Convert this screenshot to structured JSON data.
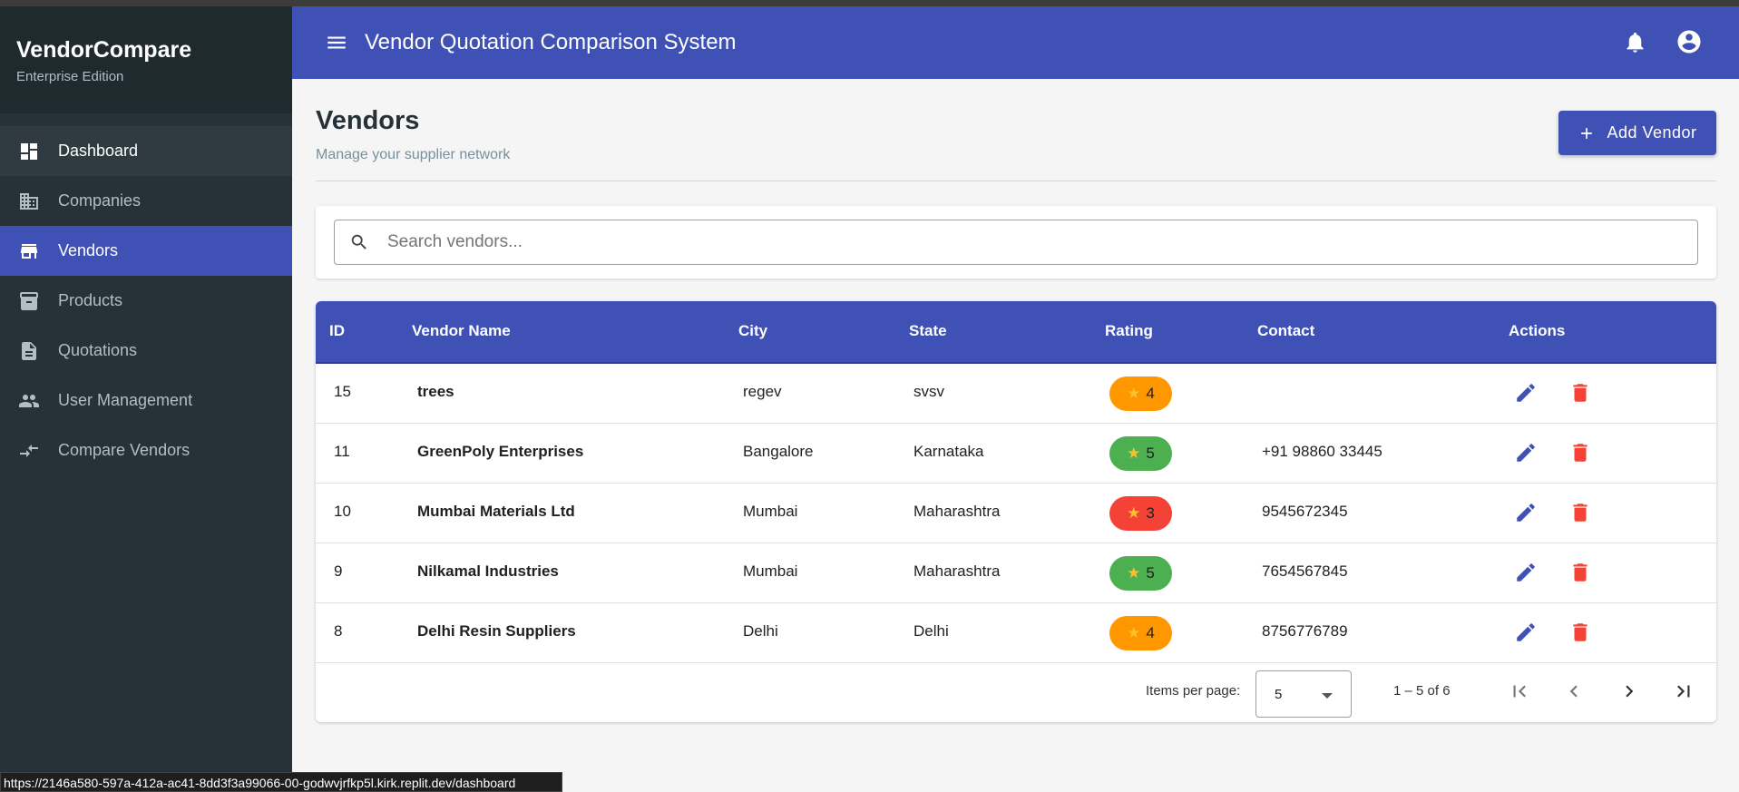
{
  "brand": {
    "title": "VendorCompare",
    "subtitle": "Enterprise Edition"
  },
  "sidebar": {
    "items": [
      {
        "label": "Dashboard",
        "icon": "dashboard-icon"
      },
      {
        "label": "Companies",
        "icon": "business-icon"
      },
      {
        "label": "Vendors",
        "icon": "store-icon",
        "active": true
      },
      {
        "label": "Products",
        "icon": "inventory-icon"
      },
      {
        "label": "Quotations",
        "icon": "document-icon"
      },
      {
        "label": "User Management",
        "icon": "people-icon"
      },
      {
        "label": "Compare Vendors",
        "icon": "compare-icon"
      }
    ]
  },
  "topbar": {
    "title": "Vendor Quotation Comparison System"
  },
  "page": {
    "title": "Vendors",
    "subtitle": "Manage your supplier network",
    "add_label": "Add Vendor"
  },
  "search": {
    "placeholder": "Search vendors...",
    "value": ""
  },
  "table": {
    "headers": {
      "id": "ID",
      "name": "Vendor Name",
      "city": "City",
      "state": "State",
      "rating": "Rating",
      "contact": "Contact",
      "actions": "Actions"
    },
    "rows": [
      {
        "id": "15",
        "name": "trees",
        "city": "regev",
        "state": "svsv",
        "rating": "4",
        "rating_color": "#ff9800",
        "contact": ""
      },
      {
        "id": "11",
        "name": "GreenPoly Enterprises",
        "city": "Bangalore",
        "state": "Karnataka",
        "rating": "5",
        "rating_color": "#4caf50",
        "contact": "+91 98860 33445"
      },
      {
        "id": "10",
        "name": "Mumbai Materials Ltd",
        "city": "Mumbai",
        "state": "Maharashtra",
        "rating": "3",
        "rating_color": "#f44336",
        "contact": "9545672345"
      },
      {
        "id": "9",
        "name": "Nilkamal Industries",
        "city": "Mumbai",
        "state": "Maharashtra",
        "rating": "5",
        "rating_color": "#4caf50",
        "contact": "7654567845"
      },
      {
        "id": "8",
        "name": "Delhi Resin Suppliers",
        "city": "Delhi",
        "state": "Delhi",
        "rating": "4",
        "rating_color": "#ff9800",
        "contact": "8756776789"
      }
    ]
  },
  "paginator": {
    "label": "Items per page:",
    "page_size": "5",
    "range": "1 – 5 of 6"
  },
  "status_url": "https://2146a580-597a-412a-ac41-8dd3f3a99066-00-godwvjrfkp5l.kirk.replit.dev/dashboard",
  "colors": {
    "primary": "#3f51b5",
    "sidebar": "#263238",
    "danger": "#f44336"
  }
}
